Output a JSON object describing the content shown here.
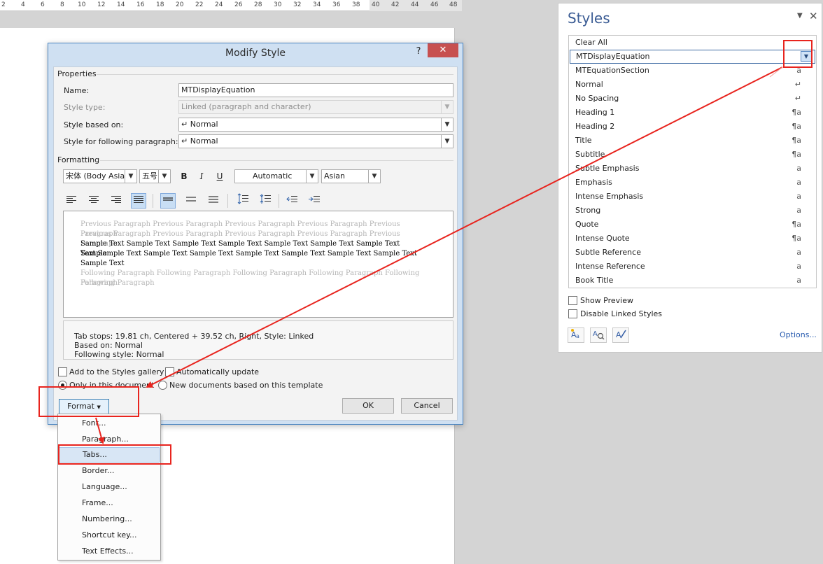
{
  "ruler": {
    "ticks": [
      "2",
      "4",
      "6",
      "8",
      "10",
      "12",
      "14",
      "16",
      "18",
      "20",
      "22",
      "24",
      "26",
      "28",
      "30",
      "32",
      "34",
      "36",
      "38",
      "40",
      "42",
      "44",
      "46",
      "48"
    ]
  },
  "dialog": {
    "title": "Modify Style",
    "help": "?",
    "close": "✕",
    "properties": {
      "group_title": "Properties",
      "name_label": "Name:",
      "name_value": "MTDisplayEquation",
      "style_type_label": "Style type:",
      "style_type_value": "Linked (paragraph and character)",
      "based_on_label": "Style based on:",
      "based_on_value": "↵ Normal",
      "following_label": "Style for following paragraph:",
      "following_value": "↵ Normal"
    },
    "formatting": {
      "group_title": "Formatting",
      "font": "宋体 (Body Asian",
      "size": "五号",
      "bold": "B",
      "italic": "I",
      "underline": "U",
      "color": "Automatic",
      "script": "Asian"
    },
    "preview": {
      "previous_1": "Previous Paragraph Previous Paragraph Previous Paragraph Previous Paragraph Previous Paragraph",
      "previous_2": "Previous Paragraph Previous Paragraph Previous Paragraph Previous Paragraph Previous Paragraph",
      "sample_1": "Sample Text Sample Text Sample Text Sample Text Sample Text Sample Text Sample Text Sample",
      "sample_2": "Text Sample Text Sample Text Sample Text Sample Text Sample Text Sample Text Sample Text",
      "sample_3": "Sample Text",
      "following_1": "Following Paragraph Following Paragraph Following Paragraph Following Paragraph Following Paragraph",
      "following_2": "Following Paragraph"
    },
    "description": {
      "line1": "Tab stops:  19.81 ch, Centered +  39.52 ch, Right, Style: Linked",
      "line2": "Based on: Normal",
      "line3": "Following style: Normal"
    },
    "add_gallery": "Add to the Styles gallery",
    "auto_update": "Automatically update",
    "only_doc": "Only in this document",
    "new_docs": "New documents based on this template",
    "format_button": "Format",
    "ok": "OK",
    "cancel": "Cancel"
  },
  "format_menu": {
    "items": [
      "Font...",
      "Paragraph...",
      "Tabs...",
      "Border...",
      "Language...",
      "Frame...",
      "Numbering...",
      "Shortcut key...",
      "Text Effects..."
    ],
    "highlighted_index": 2
  },
  "styles_pane": {
    "title": "Styles",
    "dropdown": "▼",
    "close": "✕",
    "items": [
      {
        "label": "Clear All",
        "symbol": ""
      },
      {
        "label": "MTDisplayEquation",
        "symbol": ""
      },
      {
        "label": "MTEquationSection",
        "symbol": "a"
      },
      {
        "label": "Normal",
        "symbol": "↵"
      },
      {
        "label": "No Spacing",
        "symbol": "↵"
      },
      {
        "label": "Heading 1",
        "symbol": "¶a"
      },
      {
        "label": "Heading 2",
        "symbol": "¶a"
      },
      {
        "label": "Title",
        "symbol": "¶a"
      },
      {
        "label": "Subtitle",
        "symbol": "¶a"
      },
      {
        "label": "Subtle Emphasis",
        "symbol": "a"
      },
      {
        "label": "Emphasis",
        "symbol": "a"
      },
      {
        "label": "Intense Emphasis",
        "symbol": "a"
      },
      {
        "label": "Strong",
        "symbol": "a"
      },
      {
        "label": "Quote",
        "symbol": "¶a"
      },
      {
        "label": "Intense Quote",
        "symbol": "¶a"
      },
      {
        "label": "Subtle Reference",
        "symbol": "a"
      },
      {
        "label": "Intense Reference",
        "symbol": "a"
      },
      {
        "label": "Book Title",
        "symbol": "a"
      }
    ],
    "show_preview": "Show Preview",
    "disable_linked": "Disable Linked Styles",
    "options": "Options...",
    "icons": [
      "new-style-icon",
      "style-inspector-icon",
      "manage-styles-icon"
    ]
  },
  "annotation_color": "#e8241e"
}
